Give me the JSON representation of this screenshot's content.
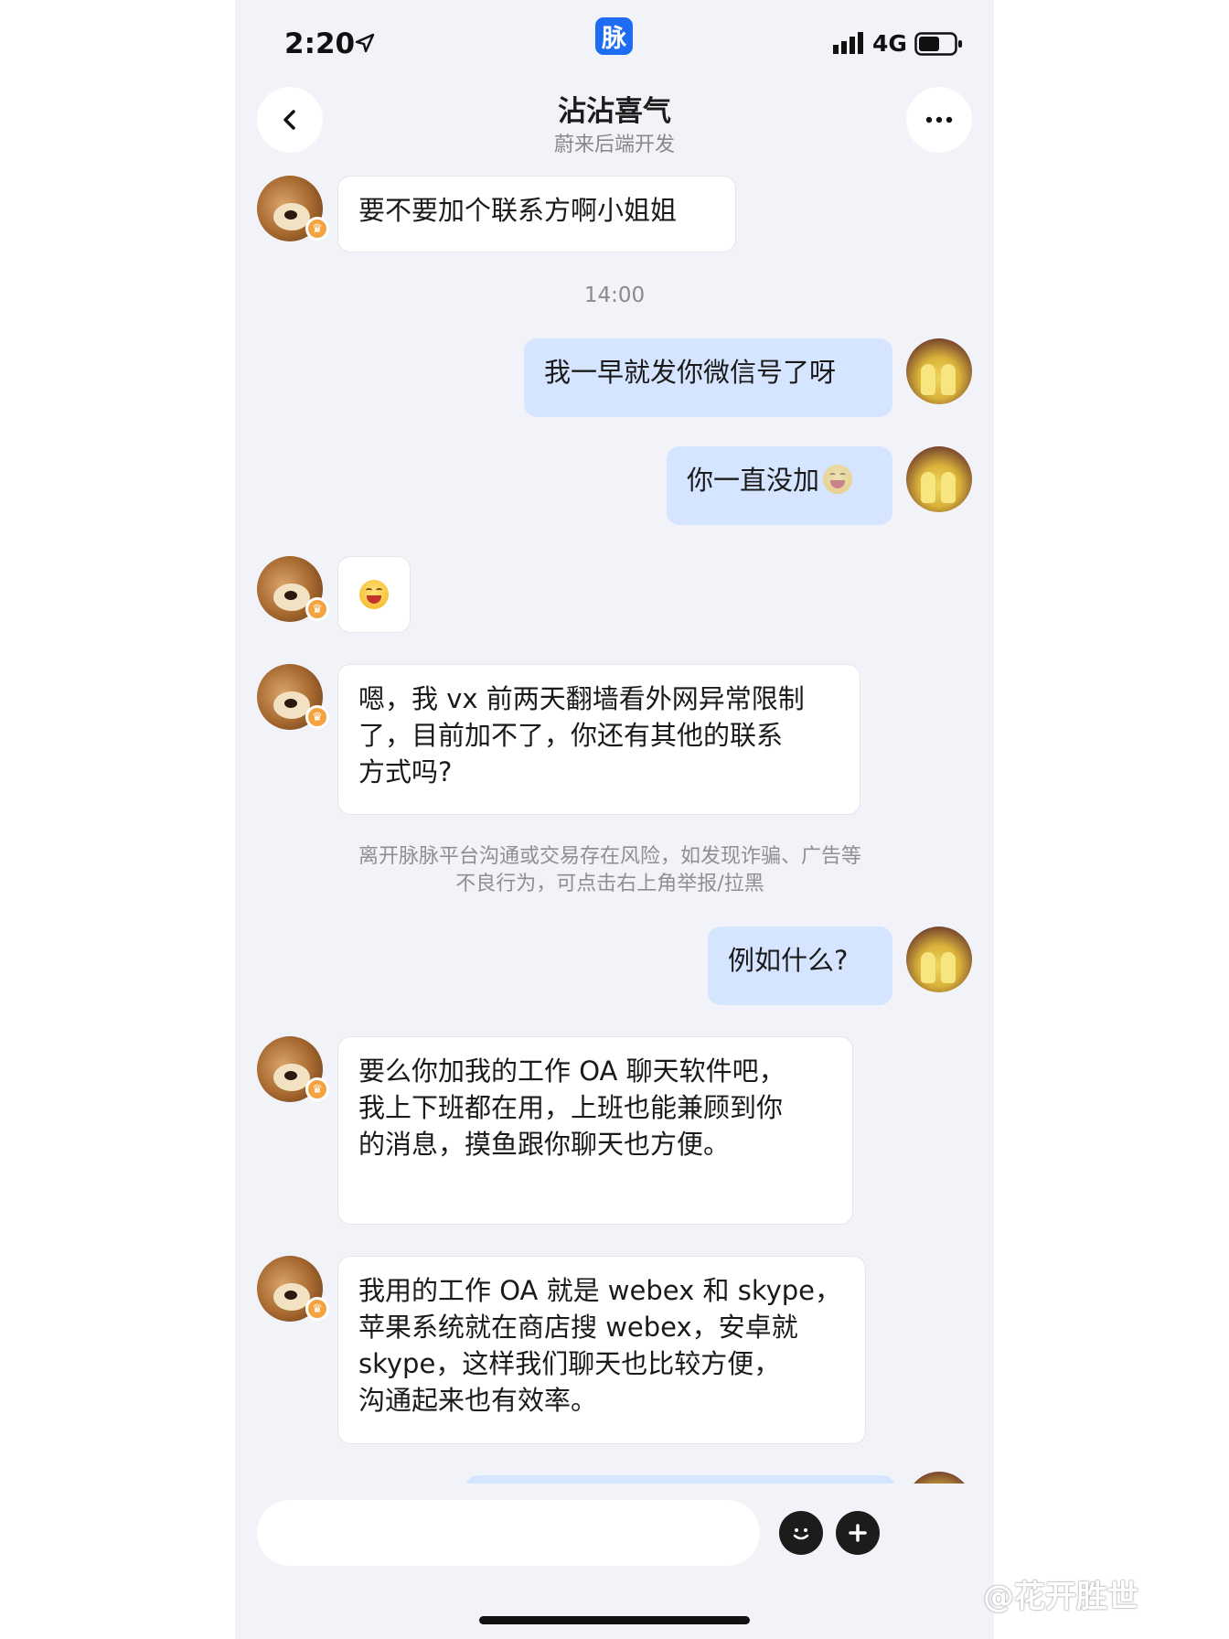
{
  "status_bar": {
    "time": "2:20",
    "app_badge": "脉",
    "network": "4G"
  },
  "header": {
    "title": "沾沾喜气",
    "subtitle": "蔚来后端开发"
  },
  "messages": {
    "m1": "要不要加个联系方啊小姐姐",
    "timestamp": "14:00",
    "m2": "我一早就发你微信号了呀",
    "m3": "你一直没加",
    "m5": "嗯，我 vx 前两天翻墙看外网异常限制\n了，目前加不了，你还有其他的联系\n方式吗?",
    "notice": "离开脉脉平台沟通或交易存在风险，如发现诈骗、广告等\n不良行为，可点击右上角举报/拉黑",
    "m6": "例如什么?",
    "m7": "要么你加我的工作 OA 聊天软件吧，\n我上下班都在用，上班也能兼顾到你\n的消息，摸鱼跟你聊天也方便。",
    "m8": "我用的工作 OA 就是 webex 和 skype，\n苹果系统就在商店搜 webex，安卓就\nskype，这样我们聊天也比较方便，\n沟通起来也有效率。"
  },
  "input": {
    "placeholder": ""
  },
  "watermark": "@花开胜世",
  "colors": {
    "outgoing_bubble": "#d6e5ff",
    "incoming_bubble": "#ffffff",
    "background": "#f2f3f8",
    "app_blue": "#1e6cf2"
  }
}
